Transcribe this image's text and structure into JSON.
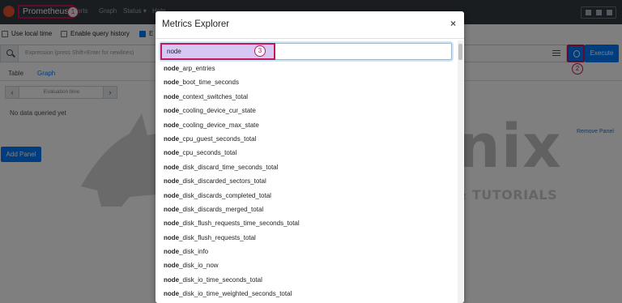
{
  "navbar": {
    "brand": "Prometheus",
    "links": [
      "Alerts",
      "Graph",
      "Status ▾",
      "Help"
    ]
  },
  "options": {
    "use_local_time": "Use local time",
    "enable_query_history": "Enable query history",
    "third_option_fragment": "E"
  },
  "search": {
    "placeholder": "Expression (press Shift+Enter for newlines)",
    "execute_label": "Execute"
  },
  "tabs": {
    "table": "Table",
    "graph": "Graph"
  },
  "graph_panel": {
    "prev": "‹",
    "next": "›",
    "evaluation_time": "Evaluation time",
    "no_data": "No data queried yet",
    "remove_panel": "Remove Panel",
    "add_panel": "Add Panel"
  },
  "watermark": {
    "brand": "Kifarunix",
    "tagline": "*NIX TIPS & TUTORIALS"
  },
  "callouts": {
    "one": "1",
    "two": "2",
    "three": "3"
  },
  "modal": {
    "title": "Metrics Explorer",
    "close": "×",
    "filter_value": "node",
    "match_prefix": "node",
    "metrics": [
      "_arp_entries",
      "_boot_time_seconds",
      "_context_switches_total",
      "_cooling_device_cur_state",
      "_cooling_device_max_state",
      "_cpu_guest_seconds_total",
      "_cpu_seconds_total",
      "_disk_discard_time_seconds_total",
      "_disk_discarded_sectors_total",
      "_disk_discards_completed_total",
      "_disk_discards_merged_total",
      "_disk_flush_requests_time_seconds_total",
      "_disk_flush_requests_total",
      "_disk_info",
      "_disk_io_now",
      "_disk_io_time_seconds_total",
      "_disk_io_time_weighted_seconds_total"
    ]
  },
  "colors": {
    "navbar": "#343a40",
    "primary": "#007bff",
    "annotation": "#c2185b",
    "highlight": "#c8b4f0"
  }
}
